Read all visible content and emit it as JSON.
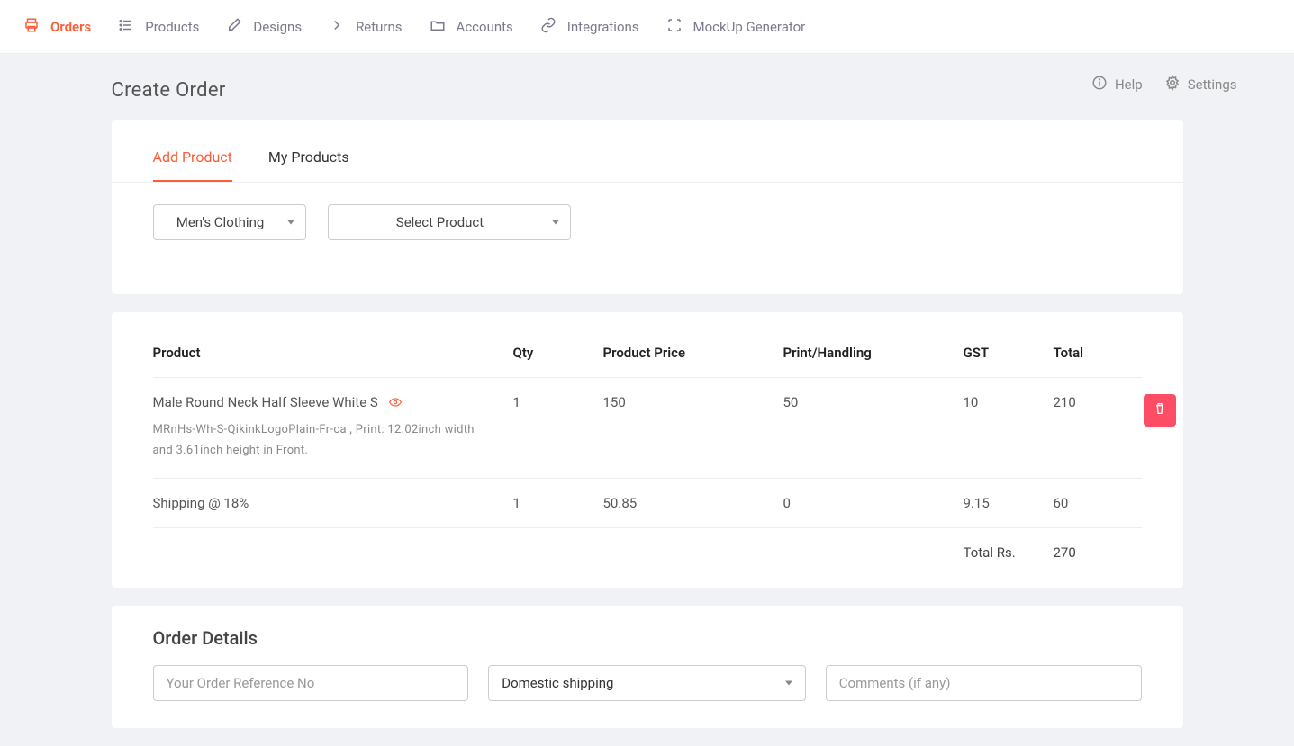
{
  "nav": {
    "items": [
      {
        "label": "Orders",
        "active": true
      },
      {
        "label": "Products"
      },
      {
        "label": "Designs"
      },
      {
        "label": "Returns"
      },
      {
        "label": "Accounts"
      },
      {
        "label": "Integrations"
      },
      {
        "label": "MockUp Generator"
      }
    ]
  },
  "header": {
    "title": "Create Order",
    "help": "Help",
    "settings": "Settings"
  },
  "tabs": {
    "add_product": "Add Product",
    "my_products": "My Products"
  },
  "selectors": {
    "category": "Men's Clothing",
    "product": "Select Product"
  },
  "table": {
    "headers": {
      "product": "Product",
      "qty": "Qty",
      "price": "Product Price",
      "print": "Print/Handling",
      "gst": "GST",
      "total": "Total"
    },
    "rows": [
      {
        "name": "Male Round Neck Half Sleeve White S",
        "detail": "MRnHs-Wh-S-QikinkLogoPlain-Fr-ca , Print: 12.02inch width and 3.61inch height in Front.",
        "qty": "1",
        "price": "150",
        "print": "50",
        "gst": "10",
        "total": "210",
        "has_preview": true,
        "deletable": true
      },
      {
        "name": "Shipping @ 18%",
        "detail": "",
        "qty": "1",
        "price": "50.85",
        "print": "0",
        "gst": "9.15",
        "total": "60",
        "has_preview": false,
        "deletable": false
      }
    ],
    "total_label": "Total Rs.",
    "total_value": "270"
  },
  "order_details": {
    "title": "Order Details",
    "reference_placeholder": "Your Order Reference No",
    "shipping_value": "Domestic shipping",
    "comments_placeholder": "Comments (if any)"
  }
}
